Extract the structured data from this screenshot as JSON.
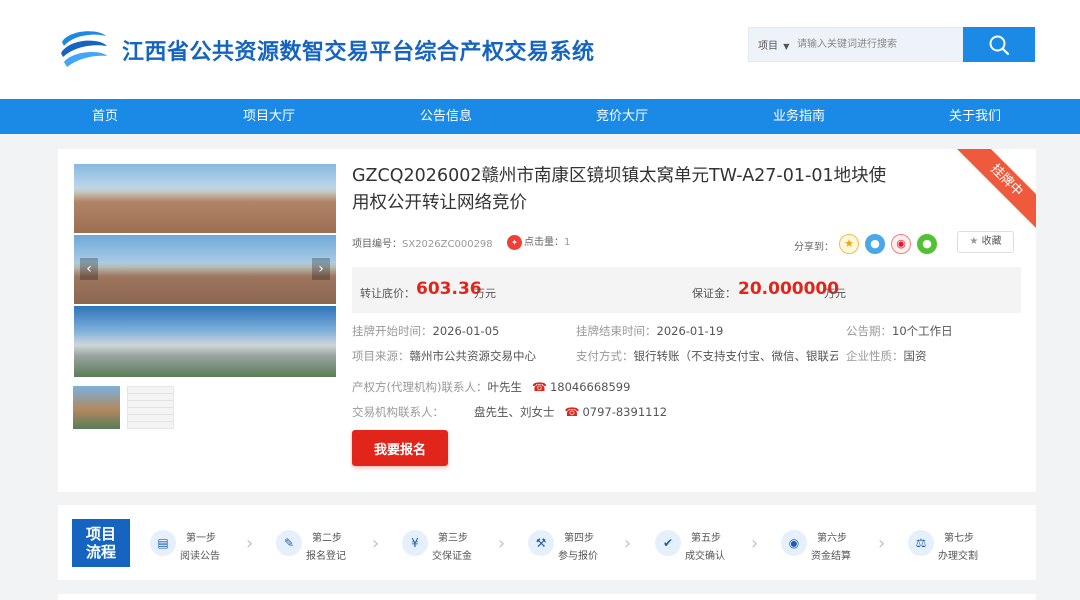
{
  "header": {
    "site_title": "江西省公共资源数智交易平台综合产权交易系统",
    "search": {
      "type_label": "项目",
      "placeholder": "请输入关键词进行搜索"
    }
  },
  "nav": [
    "首页",
    "项目大厅",
    "公告信息",
    "竞价大厅",
    "业务指南",
    "关于我们"
  ],
  "project": {
    "status_ribbon": "挂牌中",
    "title": "GZCQ2026002赣州市南康区镜坝镇太窝单元TW-A27-01-01地块使用权公开转让网络竞价",
    "code_label": "项目编号：",
    "code": "SX2026ZC000298",
    "hits_label": "点击量：",
    "hits": "1",
    "share_label": "分享到：",
    "favorite_label": "收藏",
    "reserve_price_label": "转让底价：",
    "reserve_price": "603.36",
    "reserve_price_unit": "万元",
    "deposit_label": "保证金：",
    "deposit": "20.000000",
    "deposit_unit": "万元",
    "listing_start_label": "挂牌开始时间：",
    "listing_start": "2026-01-05",
    "listing_end_label": "挂牌结束时间：",
    "listing_end": "2026-01-19",
    "announce_period_label": "公告期：",
    "announce_period": "10个工作日",
    "source_label": "项目来源：",
    "source": "赣州市公共资源交易中心",
    "payment_label": "支付方式：",
    "payment": "银行转账（不支持支付宝、微信、银联云闪…",
    "enterprise_label": "企业性质：",
    "enterprise": "国资",
    "owner_contact_label": "产权方(代理机构)联系人：",
    "owner_contact": "叶先生",
    "owner_phone": "18046668599",
    "agency_contact_label": "交易机构联系人：",
    "agency_contact": "盘先生、刘女士",
    "agency_phone": "0797-8391112",
    "signup_label": "我要报名"
  },
  "process": {
    "title_line1": "项目",
    "title_line2": "流程",
    "steps": [
      {
        "num": "第一步",
        "name": "阅读公告",
        "icon": "document-icon"
      },
      {
        "num": "第二步",
        "name": "报名登记",
        "icon": "register-icon"
      },
      {
        "num": "第三步",
        "name": "交保证金",
        "icon": "shield-yen-icon"
      },
      {
        "num": "第四步",
        "name": "参与报价",
        "icon": "gavel-icon"
      },
      {
        "num": "第五步",
        "name": "成交确认",
        "icon": "check-circle-icon"
      },
      {
        "num": "第六步",
        "name": "资金结算",
        "icon": "money-icon"
      },
      {
        "num": "第七步",
        "name": "办理交割",
        "icon": "scale-icon"
      }
    ]
  },
  "colors": {
    "brand_blue": "#1a8ae6",
    "title_blue": "#1565c0",
    "price_red": "#e1251b",
    "ribbon": "#ef5a3c"
  }
}
